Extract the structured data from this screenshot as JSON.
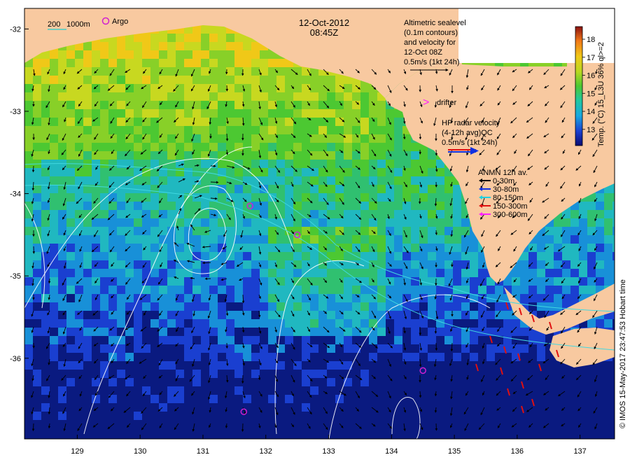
{
  "title": {
    "date": "12-Oct-2012",
    "time": "08:45Z"
  },
  "legend_top_left": {
    "isobath": "200",
    "isobath2": "1000m",
    "argo": "Argo"
  },
  "altimetry_note": {
    "lines": [
      "Altimetric sealevel",
      "(0.1m contours)",
      "and velocity for",
      "12-Oct 08Z",
      "0.5m/s (1kt 24h)"
    ]
  },
  "drifter_note": {
    "label": "drifter"
  },
  "hf_radar_note": {
    "lines": [
      "HF radar velocity",
      "(4-12h avg)QC",
      "0.5m/s (1kt 24h)"
    ]
  },
  "anmn_legend": {
    "title": "ANMN 12h av.",
    "items": [
      {
        "label": "0-30m",
        "color": "#000000"
      },
      {
        "label": "30-80m",
        "color": "#1030e0"
      },
      {
        "label": "80-150m",
        "color": "#20d0e0"
      },
      {
        "label": "150-300m",
        "color": "#e01010"
      },
      {
        "label": "300-600m",
        "color": "#ff20ff"
      }
    ]
  },
  "colorbar": {
    "ticks": [
      "18",
      "17",
      "16",
      "15",
      "14",
      "13"
    ],
    "label": "Temp. (°C) 15_L3U 36% ql>=2"
  },
  "credit": "© IMOS 15-May-2017 23:47:53 Hobart time",
  "axes": {
    "x_ticks": [
      "129",
      "130",
      "131",
      "132",
      "133",
      "134",
      "135",
      "136",
      "137"
    ],
    "y_ticks": [
      "-32",
      "-33",
      "-34",
      "-35",
      "-36"
    ]
  },
  "colors": {
    "land": "#f8c9a0",
    "cold": "#1a2f9a",
    "warm": "#f2c21a",
    "mid": "#5cc83a"
  },
  "argo_floats": [
    {
      "lon": 131.75,
      "lat": -34.15
    },
    {
      "lon": 132.5,
      "lat": -34.5
    },
    {
      "lon": 134.5,
      "lat": -36.15
    },
    {
      "lon": 131.65,
      "lat": -36.65
    }
  ]
}
